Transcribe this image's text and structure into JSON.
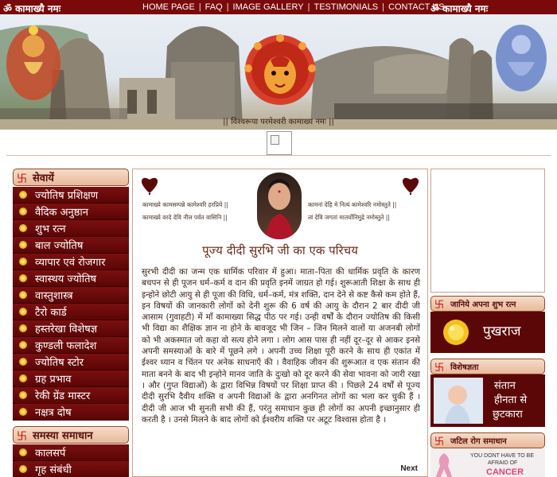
{
  "header": {
    "brand_left": "ॐ कामाख्यै नमः",
    "brand_right": "ॐ कामाख्यै नमः",
    "nav": [
      {
        "label": "HOME PAGE"
      },
      {
        "label": "FAQ"
      },
      {
        "label": "IMAGE GALLERY"
      },
      {
        "label": "TESTIMONIALS"
      },
      {
        "label": "CONTACT US"
      }
    ],
    "separator": "|"
  },
  "banner": {
    "caption": "|| विश्वरूपा परमेश्वरी कामाख्य नमः ||"
  },
  "sidebar": {
    "services": {
      "title": "सेवायें",
      "items": [
        {
          "label": "ज्योतिष प्रशिक्षण"
        },
        {
          "label": "वैदिक अनुष्ठान"
        },
        {
          "label": "शुभ रत्न"
        },
        {
          "label": "बाल ज्योतिष"
        },
        {
          "label": "व्यापार एवं रोजगार"
        },
        {
          "label": "स्वास्थय ज्योतिष"
        },
        {
          "label": "वास्तुशास्त्र"
        },
        {
          "label": "टैरो कार्ड"
        },
        {
          "label": "हस्तरेखा विशेषज्ञ"
        },
        {
          "label": "कुण्डली फलादेश"
        },
        {
          "label": "ज्योतिष स्टोर"
        },
        {
          "label": "ग्रह प्रभाव"
        },
        {
          "label": "रेकी ग्रेंड मास्टर"
        },
        {
          "label": "नक्षत्र दोष"
        }
      ]
    },
    "solutions": {
      "title": "समस्या समाधान",
      "items": [
        {
          "label": "कालसर्प"
        },
        {
          "label": "गृह संबंधी"
        }
      ]
    }
  },
  "center": {
    "mantra_left_1": "कामाख्ये कामसम्पन्ने कामेश्वरि हरप्रिये ||",
    "mantra_left_2": "कामाख्ये वरदे देवि नील पर्वत वासिनि ||",
    "mantra_right_1": "कामनां देहि मे नित्यं कामेश्वरि नमोस्तुते ||",
    "mantra_right_2": "त्वं देवि जगतां मातर्योनिमुद्रे नमोस्तुते ||",
    "heading": "पूज्य दीदी सुरभि जी का एक परिचय",
    "paragraph": "सुरभी दीदी का जन्म एक धार्मिक परिवार में हुआ। माता–पिता की धार्मिक प्रवृति के कारण बचपन से ही पूजन धर्म–कर्म व दान की प्रवृति इनमें जाग्रत हो गई। शुरूआती शिक्षा के साथ ही इन्होने छोटी आयु से ही पूजा की विधि, धर्म–कर्म, मंत्र शक्ति, दान देने से कष्ट कैसे कम होते हैं, इन विषयों की जानकारी लोगों को देनी शुरू की 6 वर्ष की आयु के दौरान 2 बार दीदी जी आसाम (गुवाहटी) में माँ कामाख्या सिद्ध पीठ पर गई। उन्ही वर्षों के दौरान ज्योतिष की किसी भी विद्या का शैक्षिक ज्ञान ना होने के बावजूद भी जिन – जिन मिलने वालों या अजनबी लोगों को भी अकस्मात जो कहा वो सत्य होने लगा । लोग आस पास ही नहीं दूर–दूर से आकर इनसे अपनी समस्याओं के बारे में पूछने लगे । अपनी उच्च शिक्षा पूरी करने के साथ ही एकांत में ईश्वर ध्यान व चिंतन पर अनेक साधनाएँ की । वैवाहिक जीवन की शुरूआत व एक संतान की माता बनने के बाद भी इन्होने मानव जाति के दुःखो को दूर करने की सेवा भावना को जारी रखा । और (गुप्त विद्याओं) के द्वारा विभिन्न विषयों पर शिक्षा प्राप्त की । पिछले 24 वर्षों से पूज्य दीदी सुरभि दैवीय शक्ति व अपनी विद्याओं के द्वारा अनगिनत लोगों का भला कर चुकी हैं । दीदी जी आज भी सुनती सभी की हैं, परंतु समाधान कुछ ही लोगों का अपनी इच्छानुसार ही करती है । उनसे मिलने के बाद लोगों को ईश्वरीय शक्ति पर अटूट विश्वास होता है ।",
    "next": "Next"
  },
  "right": {
    "lucky_stone": {
      "title": "जानिये अपना शुभ रत्न",
      "gem": "पुखराज"
    },
    "expertise": {
      "title": "विशेषज्ञता",
      "line1": "संतान",
      "line2": "हीनता से",
      "line3": "छुटकारा"
    },
    "complex_disease": {
      "title": "जटिल रोग समाधान",
      "ad_line1": "YOU DONT HAVE TO BE",
      "ad_line2": "AFRAID OF",
      "ad_line3": "CANCER"
    }
  },
  "colors": {
    "maroon": "#5c0707",
    "nav_bg": "#7a0a0a",
    "menu_gold": "#e8b10c",
    "swastik": "#c60000"
  }
}
